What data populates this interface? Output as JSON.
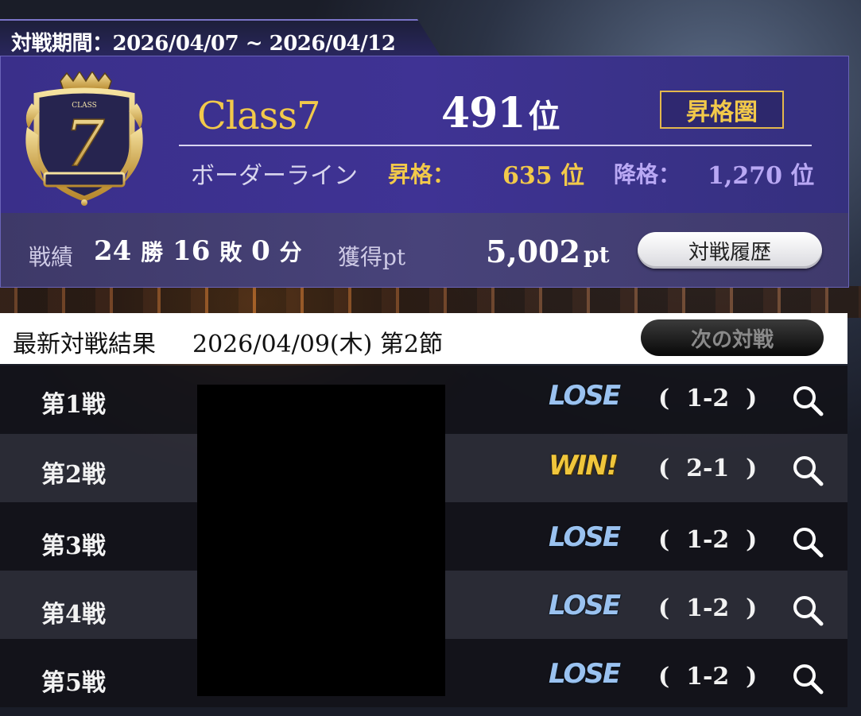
{
  "period": {
    "text": "対戦期間：2026/04/07 ~ 2026/04/12"
  },
  "ranking": {
    "class_name": "Class7",
    "rank": "491",
    "rank_unit": "位",
    "badge": "昇格圏",
    "emblem_label": "CLASS",
    "emblem_number": "7",
    "border_label": "ボーダーライン",
    "promotion_label": "昇格：",
    "promotion_value": "635 位",
    "demotion_label": "降格：",
    "demotion_value": "1,270 位"
  },
  "stats": {
    "record_label": "戦績",
    "wins": "24",
    "wins_unit": "勝",
    "losses": "16",
    "losses_unit": "敗",
    "draws": "0",
    "draws_unit": "分",
    "points_label": "獲得pt",
    "points_value": "5,002",
    "points_unit": "pt",
    "history_button": "対戦履歴"
  },
  "latest": {
    "label": "最新対戦結果",
    "date": "2026/04/09(木) 第2節",
    "next_button": "次の対戦"
  },
  "matches": [
    {
      "label": "第1戦",
      "result": "LOSE",
      "score": "(  1-2  )"
    },
    {
      "label": "第2戦",
      "result": "WIN!",
      "score": "(  2-1  )"
    },
    {
      "label": "第3戦",
      "result": "LOSE",
      "score": "(  1-2  )"
    },
    {
      "label": "第4戦",
      "result": "LOSE",
      "score": "(  1-2  )"
    },
    {
      "label": "第5戦",
      "result": "LOSE",
      "score": "(  1-2  )"
    }
  ],
  "colors": {
    "gold": "#f2c94a",
    "demotion": "#b9a8f4",
    "panel": "#3a2f8a",
    "win": "#f0c63c",
    "lose": "#9ac2f0"
  },
  "icons": {
    "emblem": "class-crest-emblem",
    "search": "search-magnifier-icon"
  }
}
